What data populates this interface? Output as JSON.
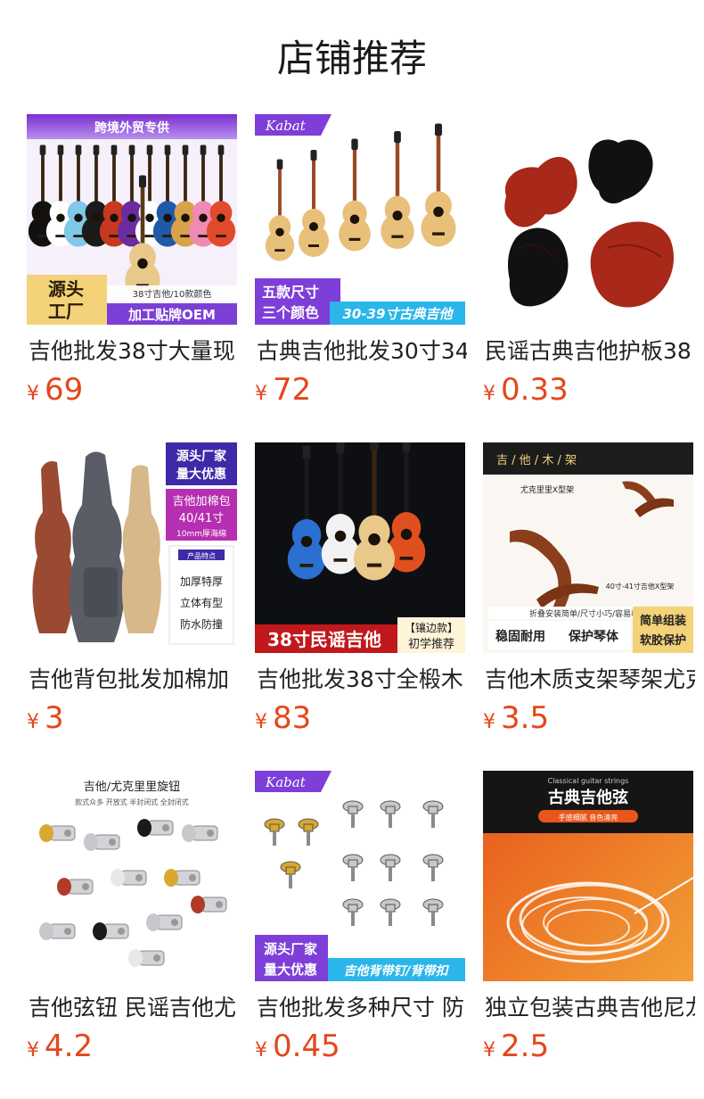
{
  "section": {
    "title": "店铺推荐"
  },
  "currency_symbol": "¥",
  "products": [
    {
      "name": "吉他批发38寸大量现",
      "price": "69",
      "image": {
        "banner": "跨境外贸专供",
        "tag1": "源头",
        "tag2": "工厂",
        "size_note": "38寸吉他/10款颜色",
        "oem": "加工贴牌OEM",
        "colors": [
          "#111111",
          "#ffffff",
          "#7ec8e8",
          "#1a1a1a",
          "#c8381e",
          "#6a2ca0",
          "#ffffff",
          "#1e5aa8",
          "#d8a24a",
          "#f08ab4",
          "#e24a2c"
        ]
      }
    },
    {
      "name": "古典吉他批发30寸34",
      "price": "72",
      "image": {
        "brand": "Kabat",
        "tag1": "五款尺寸",
        "tag2": "三个颜色",
        "banner": "30-39寸古典吉他"
      }
    },
    {
      "name": "民谣古典吉他护板38",
      "price": "0.33",
      "image": {
        "colors": [
          "#a8281a",
          "#111111",
          "#111111",
          "#a8281a"
        ]
      }
    },
    {
      "name": "吉他背包批发加棉加",
      "price": "3",
      "image": {
        "tag1": "源头厂家",
        "tag2": "量大优惠",
        "sub1": "吉他加棉包",
        "sub2": "40/41寸",
        "sub3": "10mm厚海绵",
        "feature_title": "产品特点",
        "features": [
          "加厚特厚",
          "立体有型",
          "防水防撞"
        ]
      }
    },
    {
      "name": "吉他批发38寸全椴木",
      "price": "83",
      "image": {
        "banner": "38寸民谣吉他",
        "badge1": "【镶边款】",
        "badge2": "初学推荐"
      }
    },
    {
      "name": "吉他木质支架琴架尤克",
      "price": "3.5",
      "image": {
        "header": "吉 / 他 / 木 / 架",
        "model": "尤克里里X型架",
        "model2": "40寸-41寸吉他X型架",
        "note": "折叠安装简单/尺寸小巧/容易收纳",
        "tag1": "稳固耐用",
        "tag2": "保护琴体",
        "tag3": "简单组装",
        "tag4": "软胶保护"
      }
    },
    {
      "name": "吉他弦钮 民谣吉他尤",
      "price": "4.2",
      "image": {
        "title": "吉他/尤克里里旋钮",
        "subtitle": "款式众多 开放式 半封闭式 全封闭式"
      }
    },
    {
      "name": "吉他批发多种尺寸 防",
      "price": "0.45",
      "image": {
        "brand": "Kabat",
        "tag1": "源头厂家",
        "tag2": "量大优惠",
        "banner": "吉他背带钉/背带扣"
      }
    },
    {
      "name": "独立包装古典吉他尼龙",
      "price": "2.5",
      "image": {
        "small": "Classical guitar strings",
        "title": "古典吉他弦",
        "sub": "手感细腻 音色清亮"
      }
    }
  ]
}
